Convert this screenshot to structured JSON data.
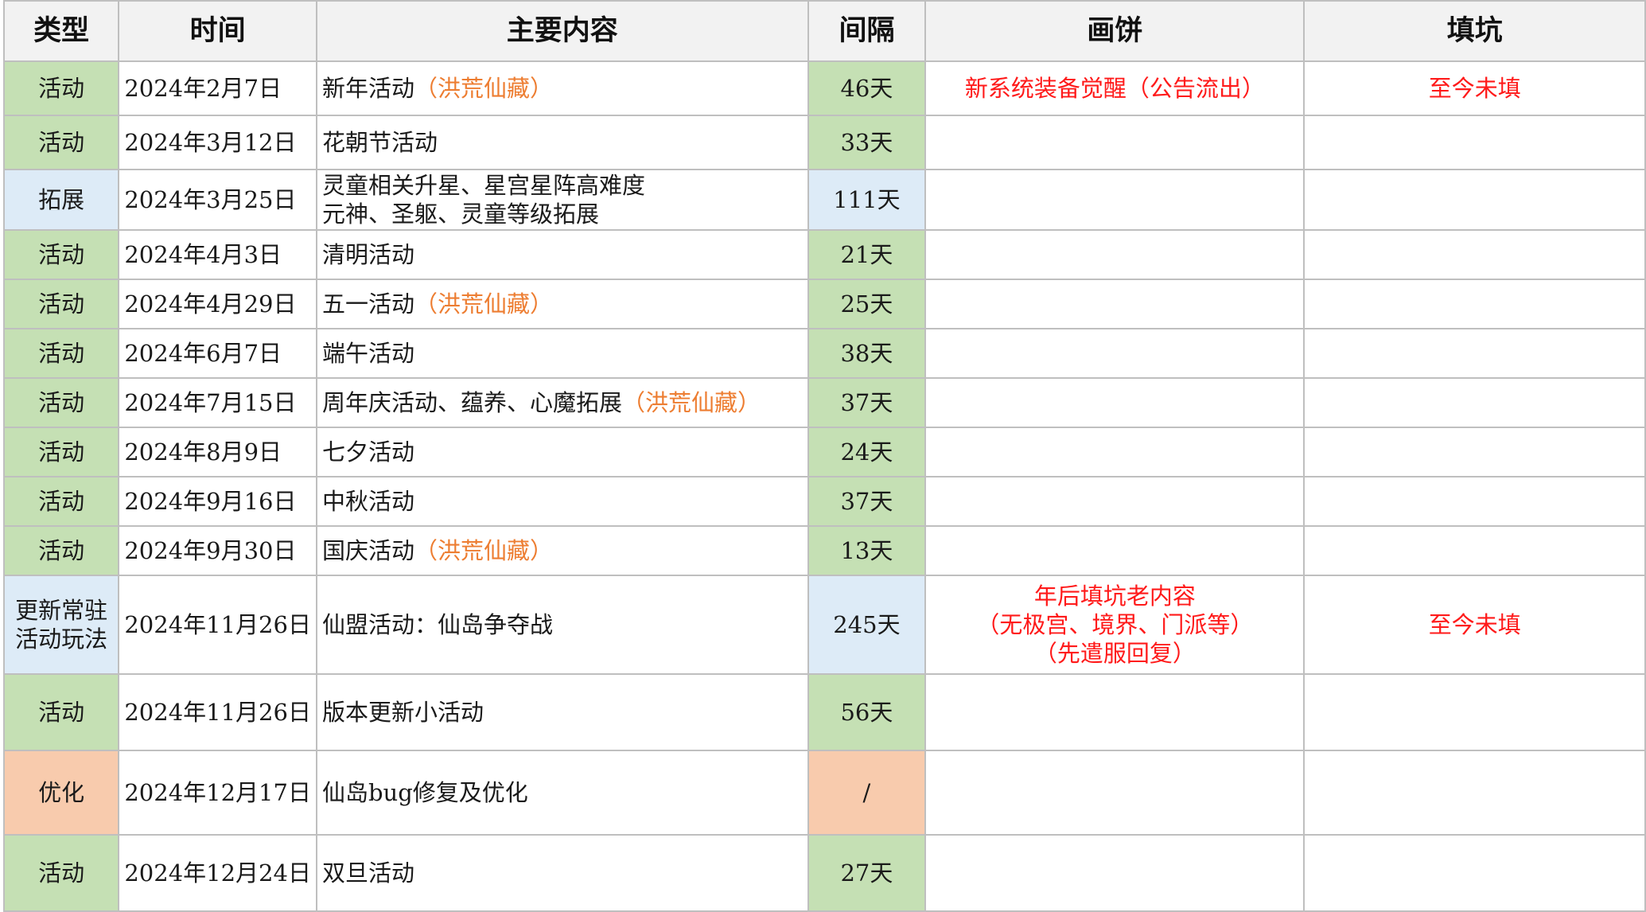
{
  "header": {
    "type": "类型",
    "time": "时间",
    "content": "主要内容",
    "gap": "间隔",
    "promise": "画饼",
    "fill": "填坑"
  },
  "colors": {
    "activity": "#c5e0b4",
    "expansion": "#ddebf7",
    "optimization": "#f8cbad",
    "highlight": "#ed7d31",
    "warning": "#ff1a1a"
  },
  "rows": [
    {
      "type": "活动",
      "time": "2024年2月7日",
      "content": "新年活动",
      "highlight": "（洪荒仙藏）",
      "gap": "46天",
      "promise": "新系统装备觉醒（公告流出）",
      "fill": "至今未填"
    },
    {
      "type": "活动",
      "time": "2024年3月12日",
      "content": "花朝节活动",
      "highlight": "",
      "gap": "33天",
      "promise": "",
      "fill": ""
    },
    {
      "type": "拓展",
      "time": "2024年3月25日",
      "content": "灵童相关升星、星宫星阵高难度",
      "content2": "元神、圣躯、灵童等级拓展",
      "highlight": "",
      "gap": "111天",
      "promise": "",
      "fill": ""
    },
    {
      "type": "活动",
      "time": "2024年4月3日",
      "content": "清明活动",
      "highlight": "",
      "gap": "21天",
      "promise": "",
      "fill": ""
    },
    {
      "type": "活动",
      "time": "2024年4月29日",
      "content": "五一活动",
      "highlight": "（洪荒仙藏）",
      "gap": "25天",
      "promise": "",
      "fill": ""
    },
    {
      "type": "活动",
      "time": "2024年6月7日",
      "content": "端午活动",
      "highlight": "",
      "gap": "38天",
      "promise": "",
      "fill": ""
    },
    {
      "type": "活动",
      "time": "2024年7月15日",
      "content": "周年庆活动、蕴养、心魔拓展",
      "highlight": "（洪荒仙藏）",
      "gap": "37天",
      "promise": "",
      "fill": ""
    },
    {
      "type": "活动",
      "time": "2024年8月9日",
      "content": "七夕活动",
      "highlight": "",
      "gap": "24天",
      "promise": "",
      "fill": ""
    },
    {
      "type": "活动",
      "time": "2024年9月16日",
      "content": "中秋活动",
      "highlight": "",
      "gap": "37天",
      "promise": "",
      "fill": ""
    },
    {
      "type": "活动",
      "time": "2024年9月30日",
      "content": "国庆活动",
      "highlight": "（洪荒仙藏）",
      "gap": "13天",
      "promise": "",
      "fill": ""
    },
    {
      "type": "更新常驻",
      "type2": "活动玩法",
      "time": "2024年11月26日",
      "content": "仙盟活动：仙岛争夺战",
      "highlight": "",
      "gap": "245天",
      "promise": "年后填坑老内容",
      "promise2": "（无极宫、境界、门派等）",
      "promise3": "（先遣服回复）",
      "fill": "至今未填"
    },
    {
      "type": "活动",
      "time": "2024年11月26日",
      "content": "版本更新小活动",
      "highlight": "",
      "gap": "56天",
      "promise": "",
      "fill": ""
    },
    {
      "type": "优化",
      "time": "2024年12月17日",
      "content": "仙岛bug修复及优化",
      "highlight": "",
      "gap": "/",
      "promise": "",
      "fill": ""
    },
    {
      "type": "活动",
      "time": "2024年12月24日",
      "content": "双旦活动",
      "highlight": "",
      "gap": "27天",
      "promise": "",
      "fill": ""
    }
  ]
}
